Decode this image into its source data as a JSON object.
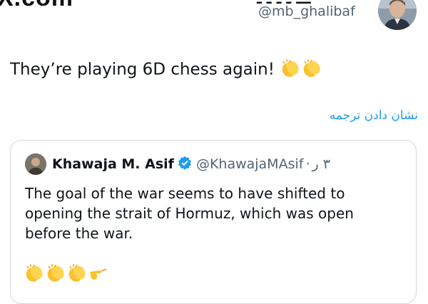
{
  "header": {
    "site_mark": "X.com",
    "display_name_cut": "ـــ ـ ـ ـ ـ",
    "handle": "@mb_ghalibaf"
  },
  "tweet": {
    "text": "They’re playing 6D chess again!"
  },
  "translate_link": "نشان دادن ترجمه",
  "quote": {
    "name": "Khawaja M. Asif",
    "handle": "@KhawajaMAsif",
    "separator": "·",
    "time": "۳ ر",
    "body": "The goal of the war seems to have shifted to opening the strait of Hormuz, which was open before the war."
  },
  "colors": {
    "link": "#1d9bf0",
    "verified": "#1d9bf0",
    "text": "#0f1419",
    "secondary": "#536471",
    "border": "#cfd9de"
  },
  "icons": {
    "clap": "clapping-hands-emoji",
    "verified": "verified-badge-icon",
    "point": "pointing-hand-emoji"
  }
}
